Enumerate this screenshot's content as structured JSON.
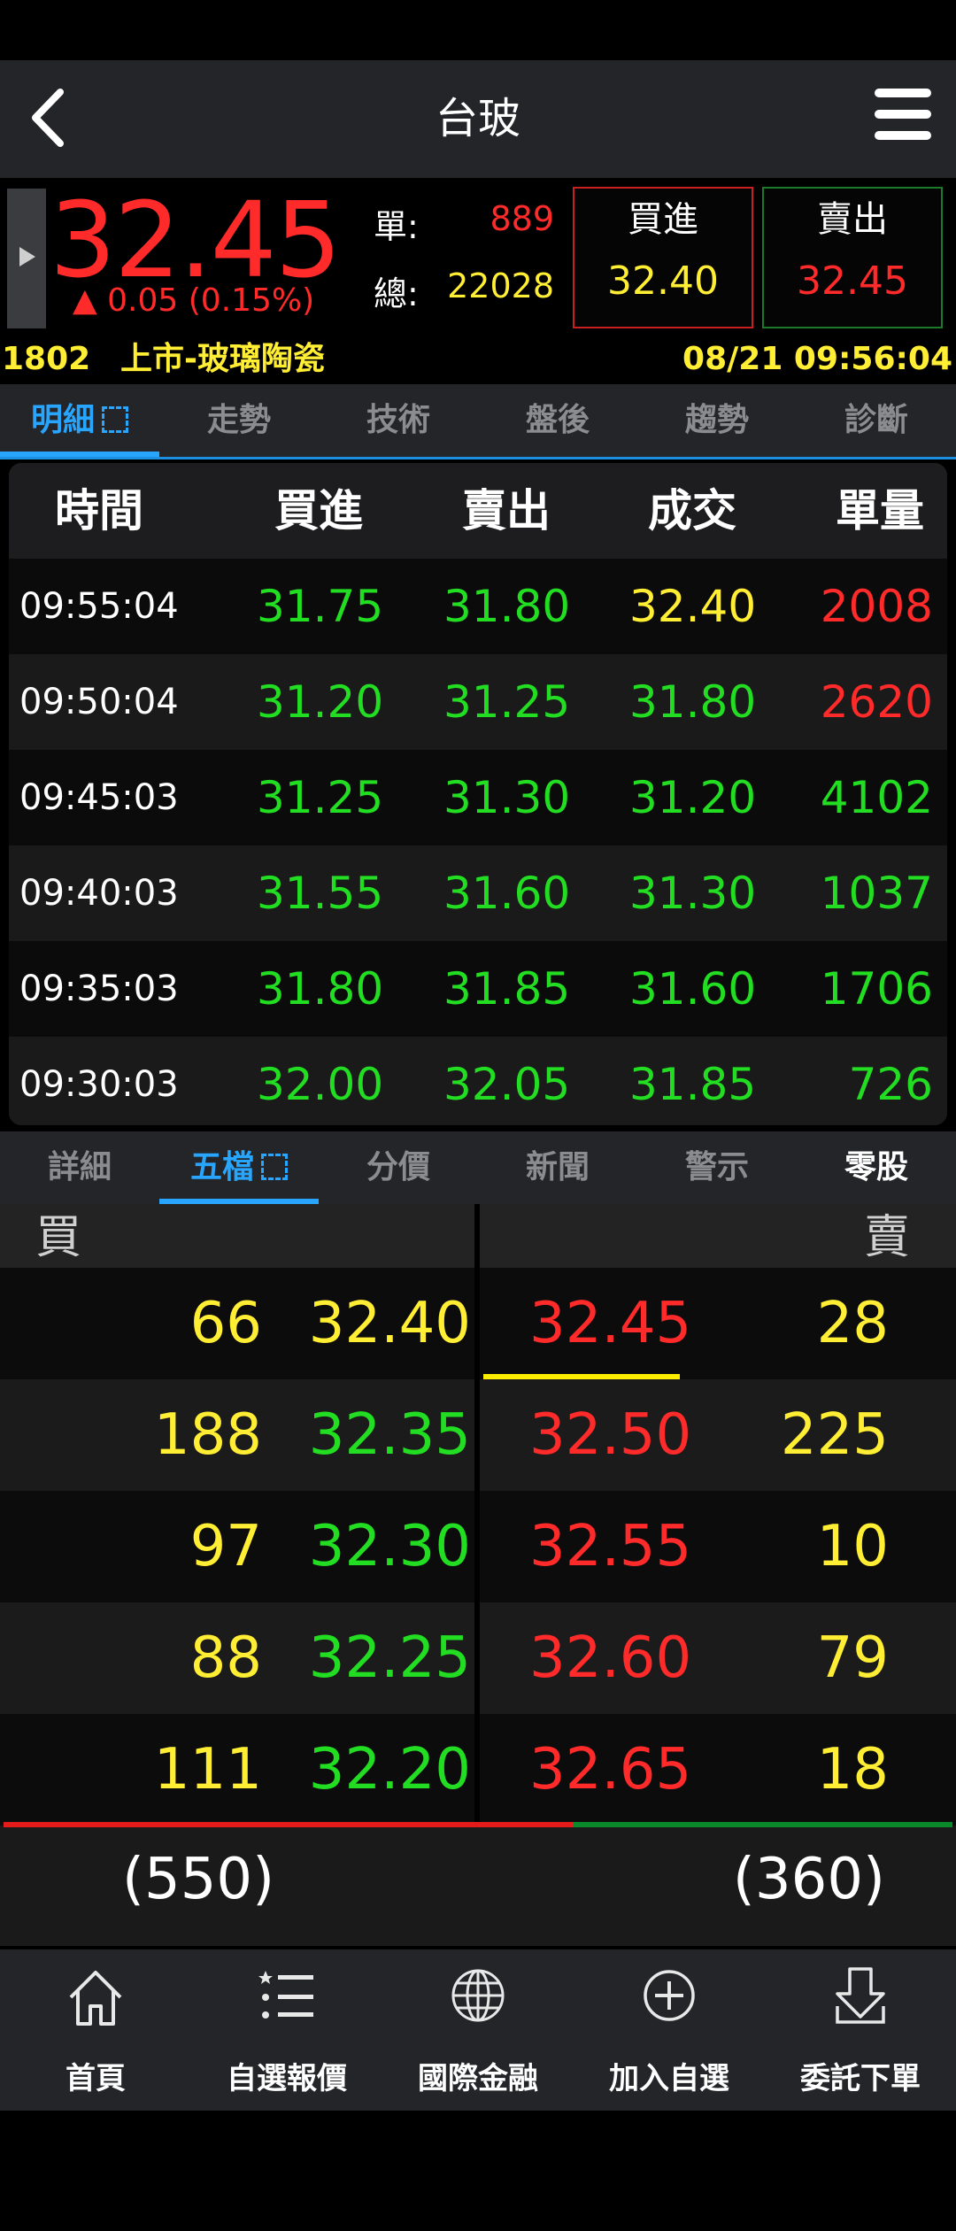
{
  "header": {
    "title": "台玻"
  },
  "quote": {
    "price": "32.45",
    "change": "▲ 0.05 (0.15%)",
    "single_label": "單:",
    "single_value": "889",
    "total_label": "總:",
    "total_value": "22028",
    "bid_title": "買進",
    "bid_value": "32.40",
    "ask_title": "賣出",
    "ask_value": "32.45",
    "code": "1802",
    "market": "上市-玻璃陶瓷",
    "datetime": "08/21 09:56:04"
  },
  "top_tabs": [
    "明細",
    "走勢",
    "技術",
    "盤後",
    "趨勢",
    "診斷"
  ],
  "detail": {
    "headers": [
      "時間",
      "買進",
      "賣出",
      "成交",
      "單量"
    ],
    "rows": [
      {
        "time": "09:55:04",
        "bid": "31.75",
        "ask": "31.80",
        "deal": "32.40",
        "vol": "2008"
      },
      {
        "time": "09:50:04",
        "bid": "31.20",
        "ask": "31.25",
        "deal": "31.80",
        "vol": "2620"
      },
      {
        "time": "09:45:03",
        "bid": "31.25",
        "ask": "31.30",
        "deal": "31.20",
        "vol": "4102"
      },
      {
        "time": "09:40:03",
        "bid": "31.55",
        "ask": "31.60",
        "deal": "31.30",
        "vol": "1037"
      },
      {
        "time": "09:35:03",
        "bid": "31.80",
        "ask": "31.85",
        "deal": "31.60",
        "vol": "1706"
      },
      {
        "time": "09:30:03",
        "bid": "32.00",
        "ask": "32.05",
        "deal": "31.85",
        "vol": "726"
      }
    ]
  },
  "lower_tabs": [
    "詳細",
    "五檔",
    "分價",
    "新聞",
    "警示",
    "零股"
  ],
  "book": {
    "buy_label": "買",
    "sell_label": "賣",
    "rows": [
      {
        "bid_qty": "66",
        "bid_price": "32.40",
        "ask_price": "32.45",
        "ask_qty": "28"
      },
      {
        "bid_qty": "188",
        "bid_price": "32.35",
        "ask_price": "32.50",
        "ask_qty": "225"
      },
      {
        "bid_qty": "97",
        "bid_price": "32.30",
        "ask_price": "32.55",
        "ask_qty": "10"
      },
      {
        "bid_qty": "88",
        "bid_price": "32.25",
        "ask_price": "32.60",
        "ask_qty": "79"
      },
      {
        "bid_qty": "111",
        "bid_price": "32.20",
        "ask_price": "32.65",
        "ask_qty": "18"
      }
    ],
    "bid_total": "(550)",
    "ask_total": "(360)",
    "bid_share": 0.6
  },
  "nav": [
    "首頁",
    "自選報價",
    "國際金融",
    "加入自選",
    "委託下單"
  ],
  "colors": {
    "up": "#ff2a2a",
    "down": "#22dd22",
    "neutral": "#ffee33",
    "accent": "#28a6ff"
  }
}
